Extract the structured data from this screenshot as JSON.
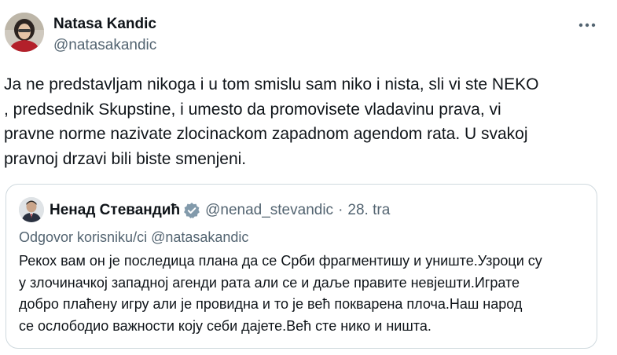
{
  "tweet": {
    "author": {
      "name": "Natasa Kandic",
      "handle": "@natasakandic",
      "avatar_icon": "user-avatar-photo"
    },
    "more_icon": "more-horizontal-icon",
    "text": "Ja ne predstavljam nikoga i u tom smislu sam niko i nista, sli vi  ste NEKO\n, predsednik Skupstine, i umesto da  promovisete vladavinu prava, vi\npravne norme nazivate zlocinackom zapadnom agendom rata. U svakoj\npravnoj drzavi bili biste smenjeni."
  },
  "quote": {
    "author": {
      "name": "Ненад Стевандић",
      "handle": "@nenad_stevandic",
      "verified_icon": "verified-badge-icon"
    },
    "separator": "·",
    "date": "28. tra",
    "reply_to": "Odgovor korisniku/ci @natasakandic",
    "text": "Рекох вам он је последица плана да се Срби фрагментишу и униште.Узроци су\nу злочиначкој западној агенди рата али се и даље правите невјешти.Играте\nдобро плаћену игру али је провидна и то је већ покварена плоча.Наш народ\nсе ослободио важности коју себи дајете.Већ сте нико и ништа."
  },
  "colors": {
    "text_primary": "#0f1419",
    "text_secondary": "#536471",
    "border": "#cfd9de",
    "verified_badge": "#829aab"
  }
}
